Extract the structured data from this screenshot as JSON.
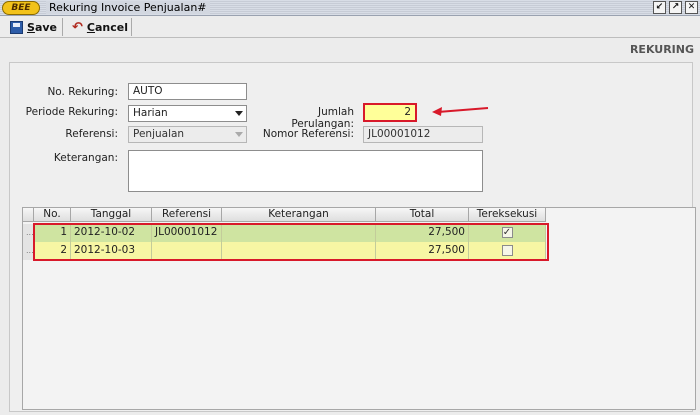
{
  "window": {
    "logo": "BEE",
    "title": "Rekuring Invoice Penjualan#",
    "buttons": [
      "↙",
      "↗",
      "✕"
    ]
  },
  "toolbar": {
    "save_label": "Save",
    "cancel_label": "Cancel"
  },
  "section_title": "REKURING",
  "form": {
    "no_rekuring_label": "No. Rekuring:",
    "no_rekuring_value": "AUTO",
    "periode_label": "Periode Rekuring:",
    "periode_value": "Harian",
    "jumlah_label": "Jumlah Perulangan:",
    "jumlah_value": "2",
    "referensi_label": "Referensi:",
    "referensi_value": "Penjualan",
    "nomor_referensi_label": "Nomor Referensi:",
    "nomor_referensi_value": "JL00001012",
    "keterangan_label": "Keterangan:",
    "keterangan_value": ""
  },
  "grid": {
    "columns": [
      "No.",
      "Tanggal",
      "Referensi",
      "Keterangan",
      "Total",
      "Tereksekusi"
    ],
    "rows": [
      {
        "no": "1",
        "tanggal": "2012-10-02",
        "referensi": "JL00001012",
        "keterangan": "",
        "total": "27,500",
        "tereksekusi": "✓"
      },
      {
        "no": "2",
        "tanggal": "2012-10-03",
        "referensi": "",
        "keterangan": "",
        "total": "27,500",
        "tereksekusi": ""
      }
    ],
    "row_handle": "..."
  },
  "colors": {
    "highlight_border": "#d8192a",
    "row_executed": "#cfe4a1",
    "row_pending": "#f7f6a4",
    "field_highlight": "#ffff99"
  }
}
